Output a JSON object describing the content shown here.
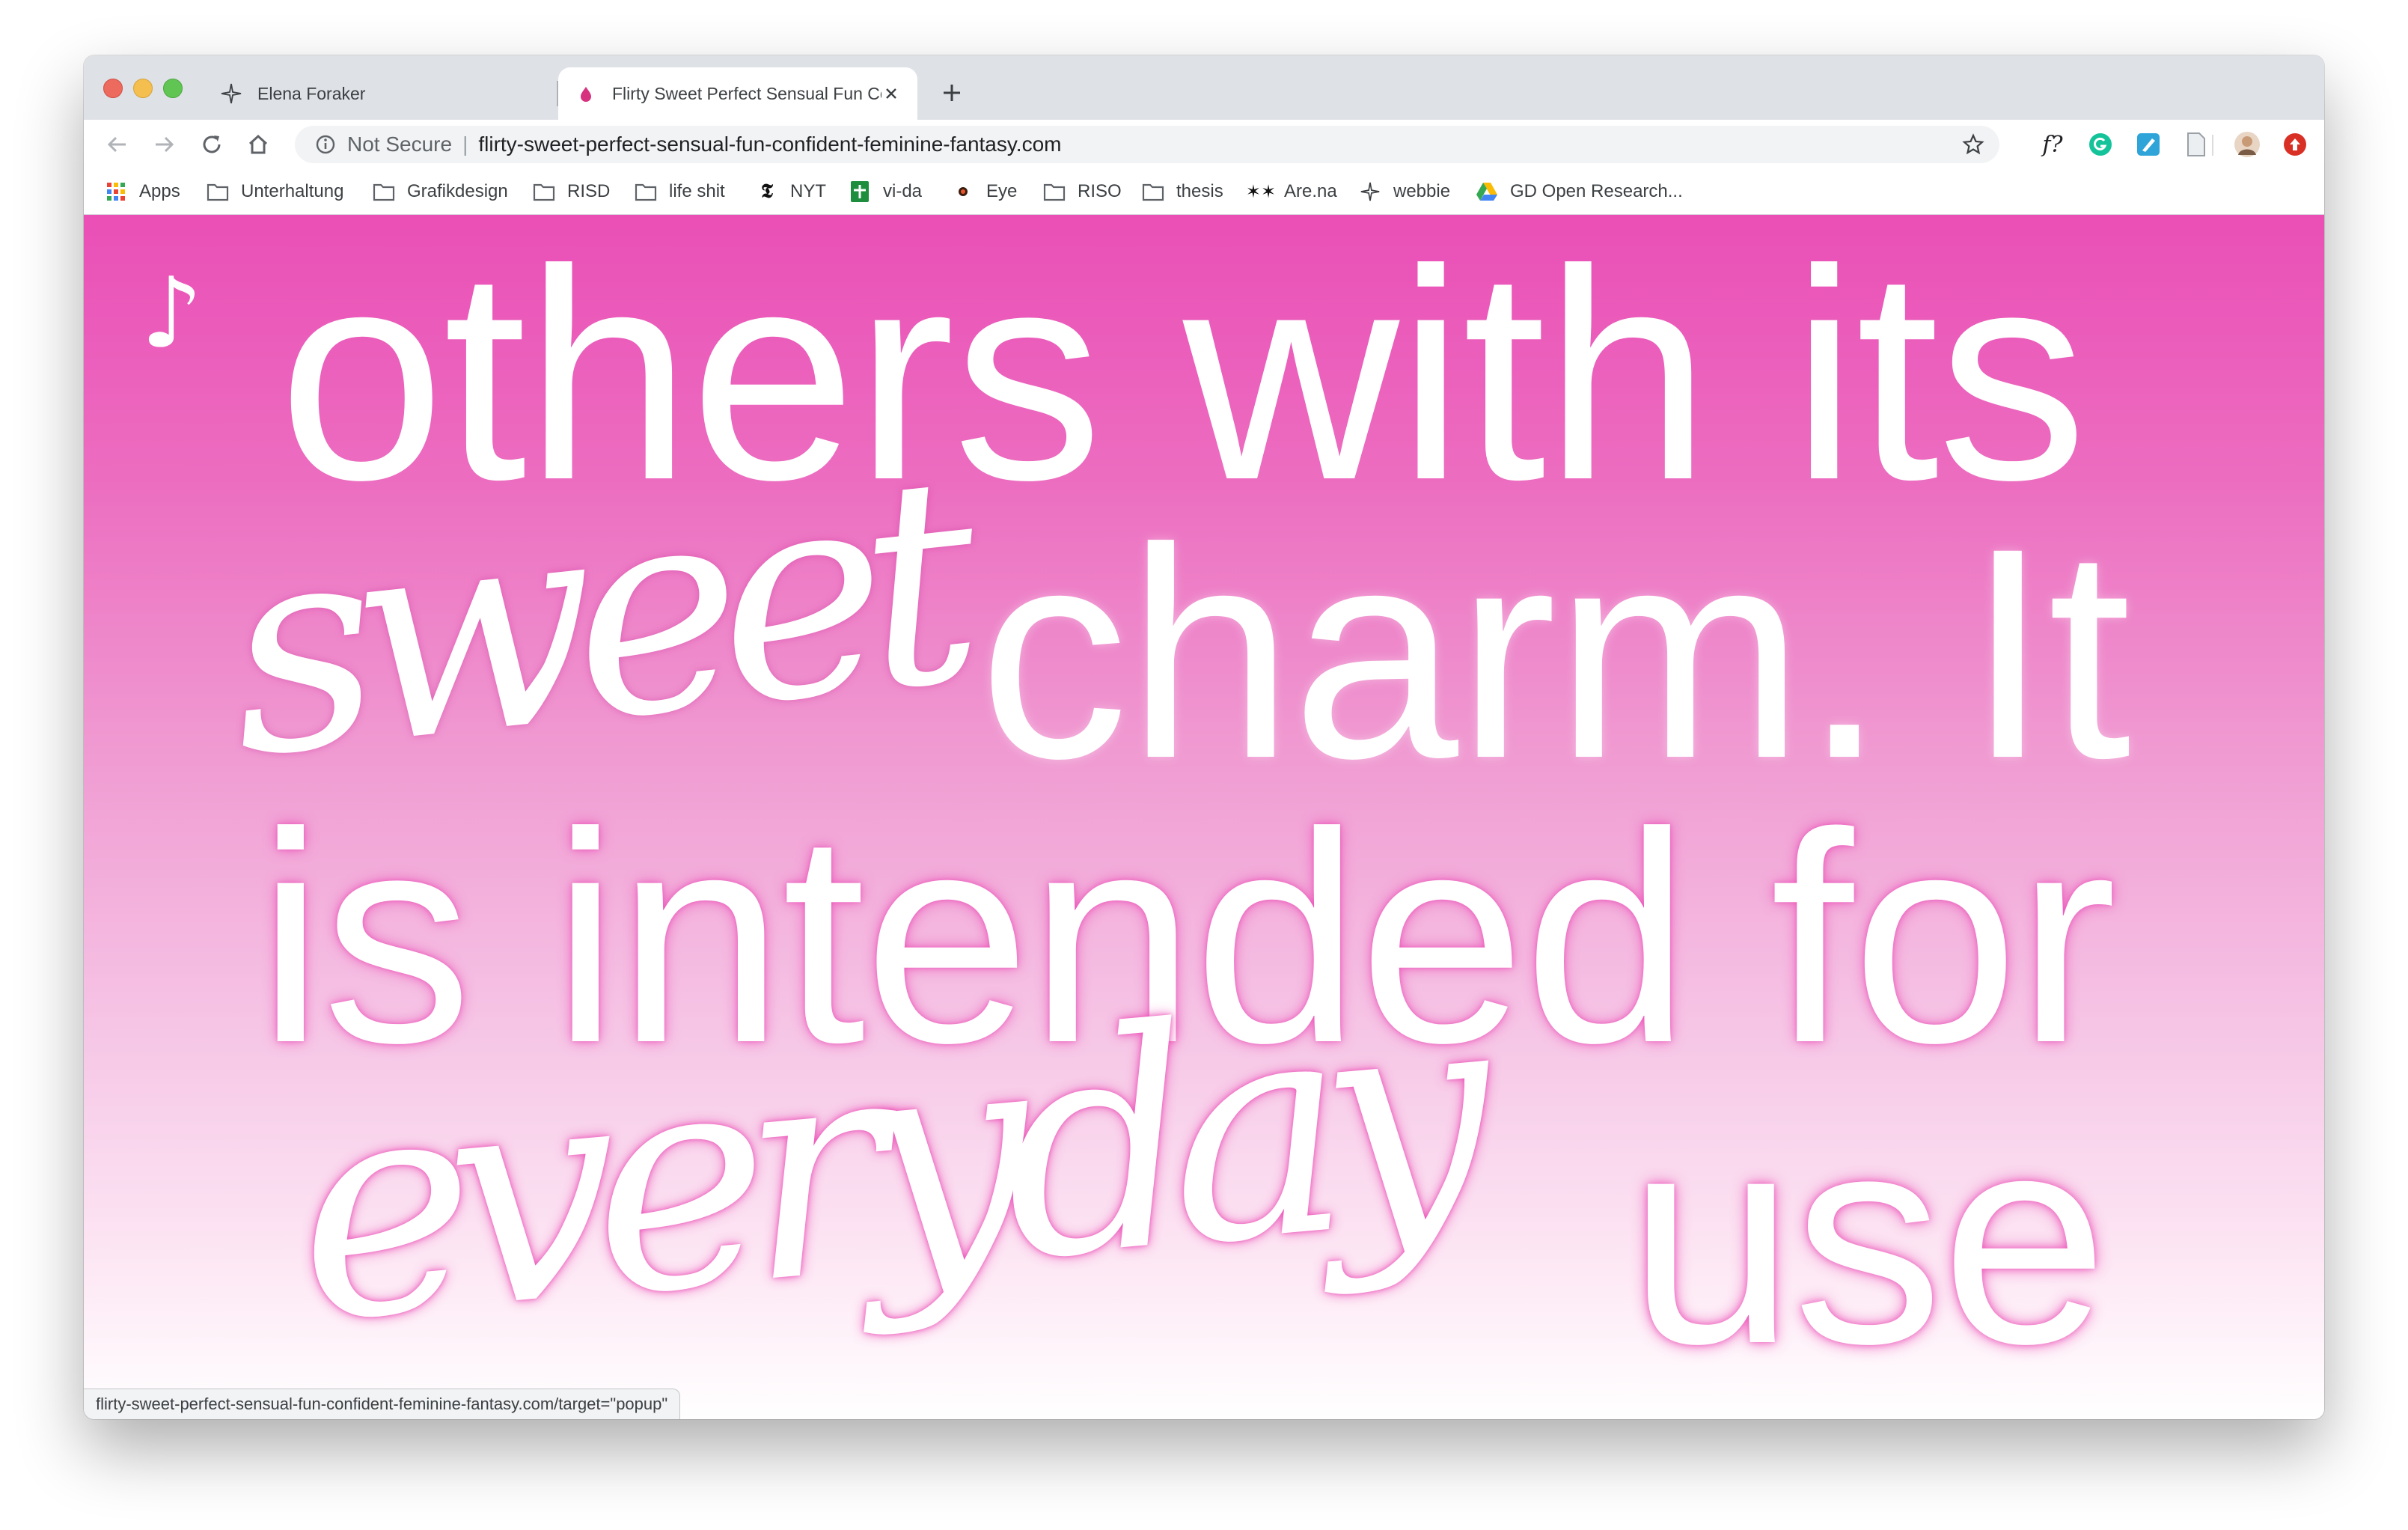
{
  "browser": {
    "tabs": [
      {
        "title": "Elena Foraker",
        "icon": "sparkle-icon",
        "active": false
      },
      {
        "title": "Flirty Sweet Perfect Sensual Fun Confident Feminine Fantasy",
        "icon": "pink-drop-icon",
        "active": true
      }
    ],
    "omnibox": {
      "security_label": "Not Secure",
      "separator": "|",
      "url": "flirty-sweet-perfect-sensual-fun-confident-feminine-fantasy.com"
    },
    "extensions": {
      "font_ext_label": "f?"
    },
    "bookmarks": [
      {
        "label": "Apps",
        "icon": "apps-grid-icon"
      },
      {
        "label": "Unterhaltung",
        "icon": "folder-icon"
      },
      {
        "label": "Grafikdesign",
        "icon": "folder-icon"
      },
      {
        "label": "RISD",
        "icon": "folder-icon"
      },
      {
        "label": "life shit",
        "icon": "folder-icon"
      },
      {
        "label": "NYT",
        "icon": "nyt-icon"
      },
      {
        "label": "vi-da",
        "icon": "green-sheet-icon"
      },
      {
        "label": "Eye",
        "icon": "eye-dot-icon"
      },
      {
        "label": "RISO",
        "icon": "folder-icon"
      },
      {
        "label": "thesis",
        "icon": "folder-icon"
      },
      {
        "label": "Are.na",
        "icon": "arena-icon"
      },
      {
        "label": "webbie",
        "icon": "sparkle-icon"
      },
      {
        "label": "GD Open Research...",
        "icon": "google-drive-icon"
      }
    ]
  },
  "page": {
    "music_note": "♪",
    "line1": "others with its",
    "script1": "sweet",
    "line2": "charm. It",
    "line3": "is intended for",
    "script2": "everyday",
    "line4": "use"
  },
  "status_bar": {
    "text": "flirty-sweet-perfect-sensual-fun-confident-feminine-fantasy.com/target=\"popup\""
  },
  "colors": {
    "gradient_top": "#ea4fb6",
    "gradient_bottom": "#ffffff",
    "text": "#ffffff",
    "glow": "#eb46b4"
  }
}
